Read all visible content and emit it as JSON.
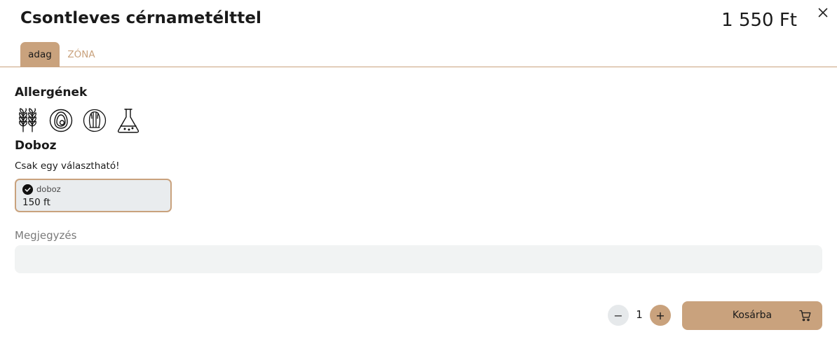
{
  "product": {
    "title": "Csontleves cérnametélttel",
    "price": "1 550 Ft"
  },
  "tabs": [
    {
      "label": "adag",
      "active": true
    },
    {
      "label": "ZÓNA",
      "active": false
    }
  ],
  "allergens": {
    "title": "Allergének",
    "icons": [
      "wheat-icon",
      "egg-icon",
      "celery-icon",
      "flask-icon"
    ]
  },
  "box": {
    "title": "Doboz",
    "hint": "Csak egy választható!",
    "options": [
      {
        "name": "doboz",
        "price": "150 ft",
        "selected": true
      }
    ]
  },
  "note": {
    "label": "Megjegyzés",
    "value": ""
  },
  "quantity": {
    "minus": "−",
    "value": "1",
    "plus": "+"
  },
  "cart": {
    "label": "Kosárba"
  },
  "colors": {
    "accent": "#c9a27d",
    "option_bg": "#e9ecee",
    "input_bg": "#f1f3f3"
  }
}
